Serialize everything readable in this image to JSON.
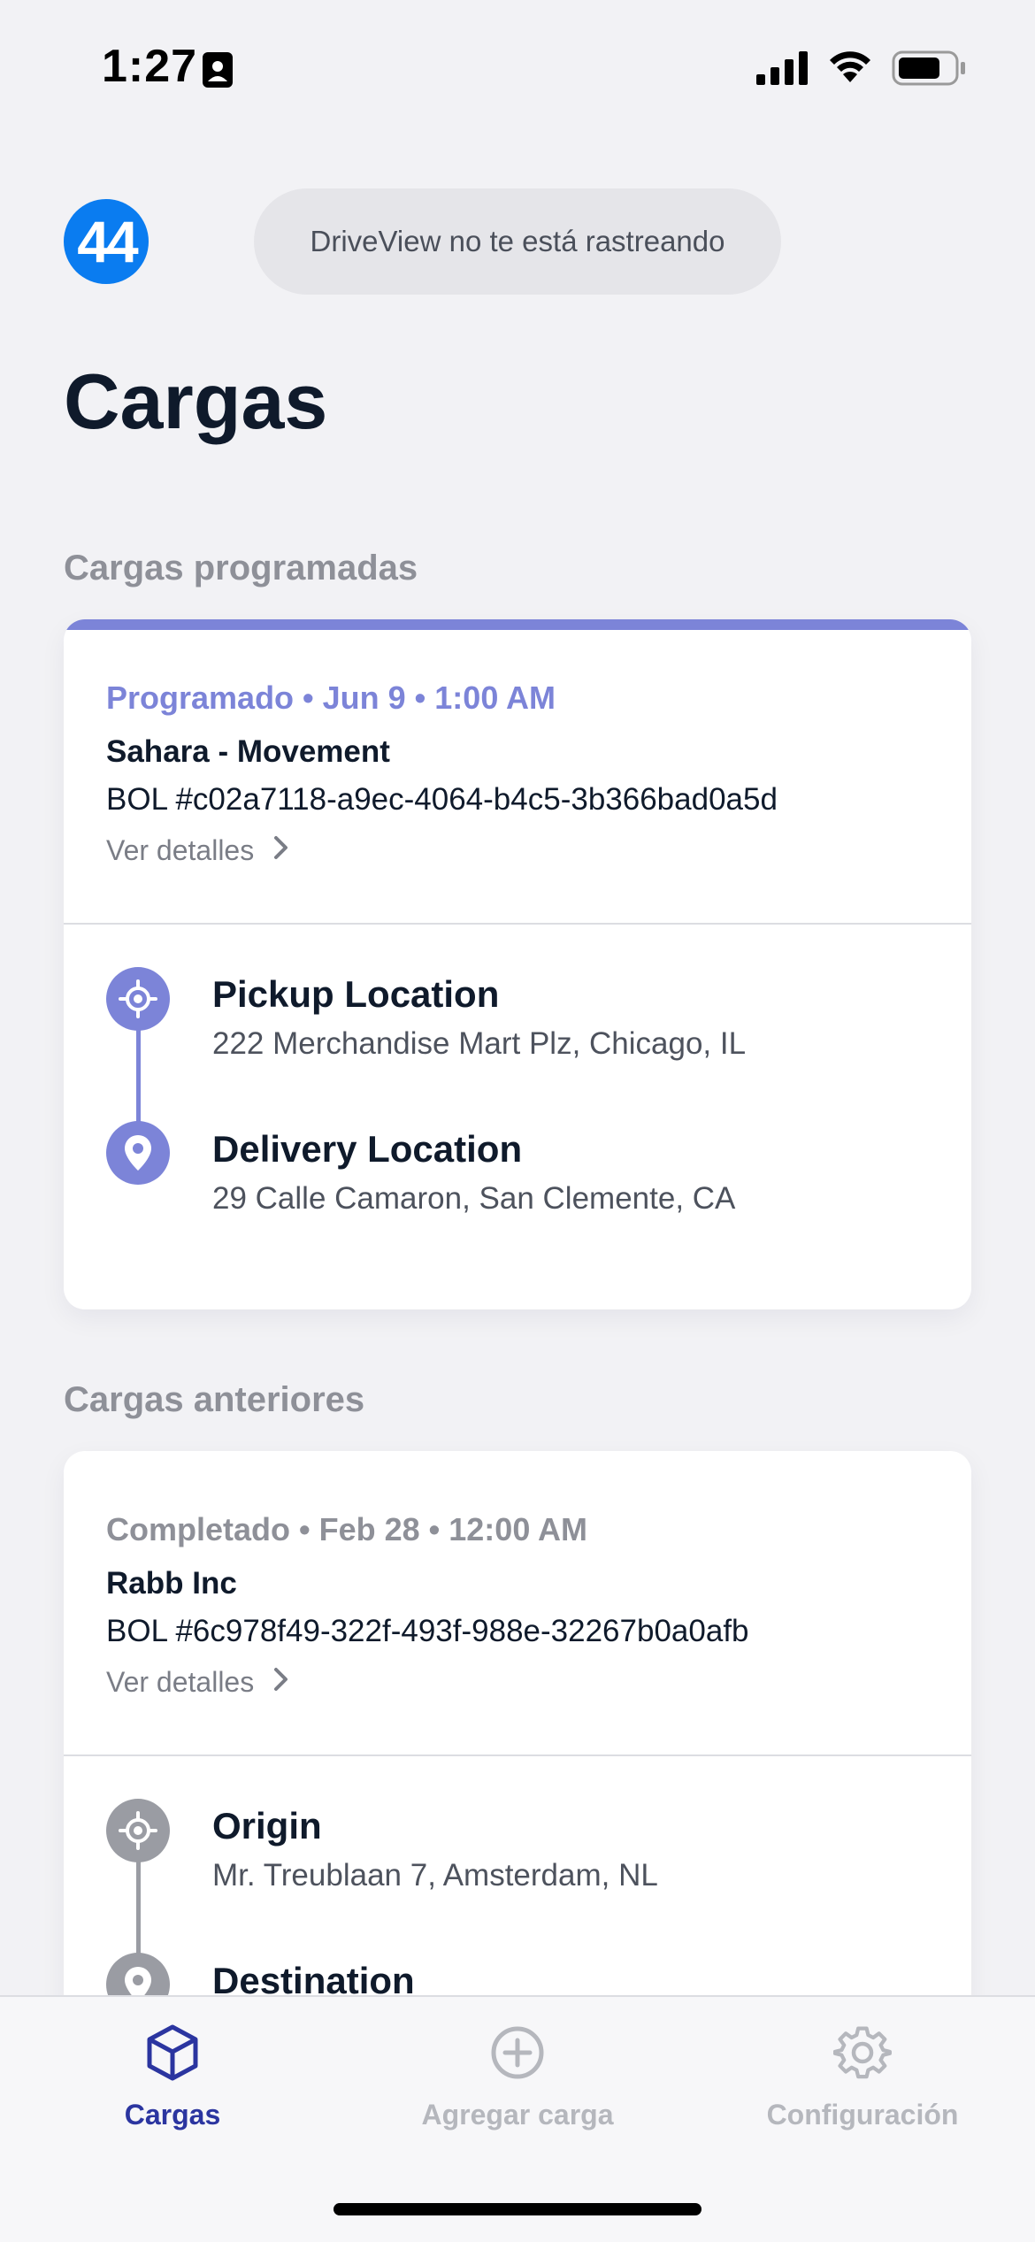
{
  "status_bar": {
    "time": "1:27"
  },
  "header": {
    "avatar_text": "44",
    "tracking_status": "DriveView no te está rastreando",
    "title": "Cargas"
  },
  "sections": {
    "scheduled_title": "Cargas programadas",
    "previous_title": "Cargas anteriores"
  },
  "scheduled_load": {
    "status_line": "Programado • Jun 9 • 1:00 AM",
    "company": "Sahara - Movement",
    "bol": "BOL #c02a7118-a9ec-4064-b4c5-3b366bad0a5d",
    "details_label": "Ver detalles",
    "pickup_title": "Pickup Location",
    "pickup_address": "222 Merchandise Mart Plz, Chicago, IL",
    "delivery_title": "Delivery Location",
    "delivery_address": "29 Calle Camaron, San Clemente, CA",
    "accent_color": "#7c84d8"
  },
  "previous_load": {
    "status_line": "Completado • Feb 28 • 12:00 AM",
    "company": "Rabb Inc",
    "bol": "BOL #6c978f49-322f-493f-988e-32267b0a0afb",
    "details_label": "Ver detalles",
    "origin_title": "Origin",
    "origin_address": "Mr. Treublaan 7, Amsterdam, NL",
    "destination_title": "Destination",
    "accent_color": "#9a9ca3"
  },
  "tab_bar": {
    "tabs": [
      {
        "label": "Cargas",
        "icon": "cube-icon",
        "active": true
      },
      {
        "label": "Agregar carga",
        "icon": "plus-circle-icon",
        "active": false
      },
      {
        "label": "Configuración",
        "icon": "gear-icon",
        "active": false
      }
    ],
    "active_color": "#2b35a0",
    "inactive_color": "#b5b7bd"
  }
}
